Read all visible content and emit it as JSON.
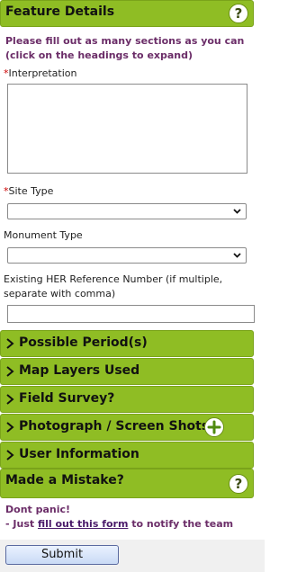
{
  "header": {
    "title": "Feature Details",
    "help_icon": "?"
  },
  "intro": "Please fill out as many sections as you can (click on the headings to expand)",
  "fields": {
    "interpretation": {
      "required_mark": "*",
      "label": "Interpretation",
      "value": ""
    },
    "site_type": {
      "required_mark": "*",
      "label": "Site Type",
      "selected": ""
    },
    "monument_type": {
      "label": "Monument Type",
      "selected": ""
    },
    "her_reference": {
      "label": "Existing HER Reference Number (if multiple, separate with comma)",
      "value": ""
    }
  },
  "sections": [
    {
      "label": "Possible Period(s)"
    },
    {
      "label": "Map Layers Used"
    },
    {
      "label": "Field Survey?"
    },
    {
      "label": "Photograph / Screen Shots",
      "icon": "plus-icon"
    },
    {
      "label": "User Information"
    }
  ],
  "mistake": {
    "title": "Made a Mistake?",
    "help_icon": "?",
    "line1": "Dont panic!",
    "line2_prefix": "- Just ",
    "link_text": "fill out this form",
    "line2_suffix": " to notify the team"
  },
  "submit_label": "Submit",
  "colors": {
    "accent_green": "#8fbd24",
    "intro_purple": "#6b2d68",
    "required_red": "#cc0000"
  }
}
